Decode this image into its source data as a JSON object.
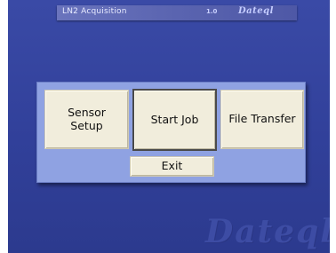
{
  "window": {
    "title": "LN2 Acquisition",
    "version": "1.0",
    "brand": "Dateql"
  },
  "menu": {
    "sensor_setup": "Sensor\nSetup",
    "start_job": "Start Job",
    "file_transfer": "File Transfer",
    "exit": "Exit"
  },
  "watermark": {
    "brand": "Dateql"
  },
  "colors": {
    "background": "#31409a",
    "panel": "#8fa2e2",
    "button": "#f1eddc",
    "titlebar": "#5a64b0"
  }
}
